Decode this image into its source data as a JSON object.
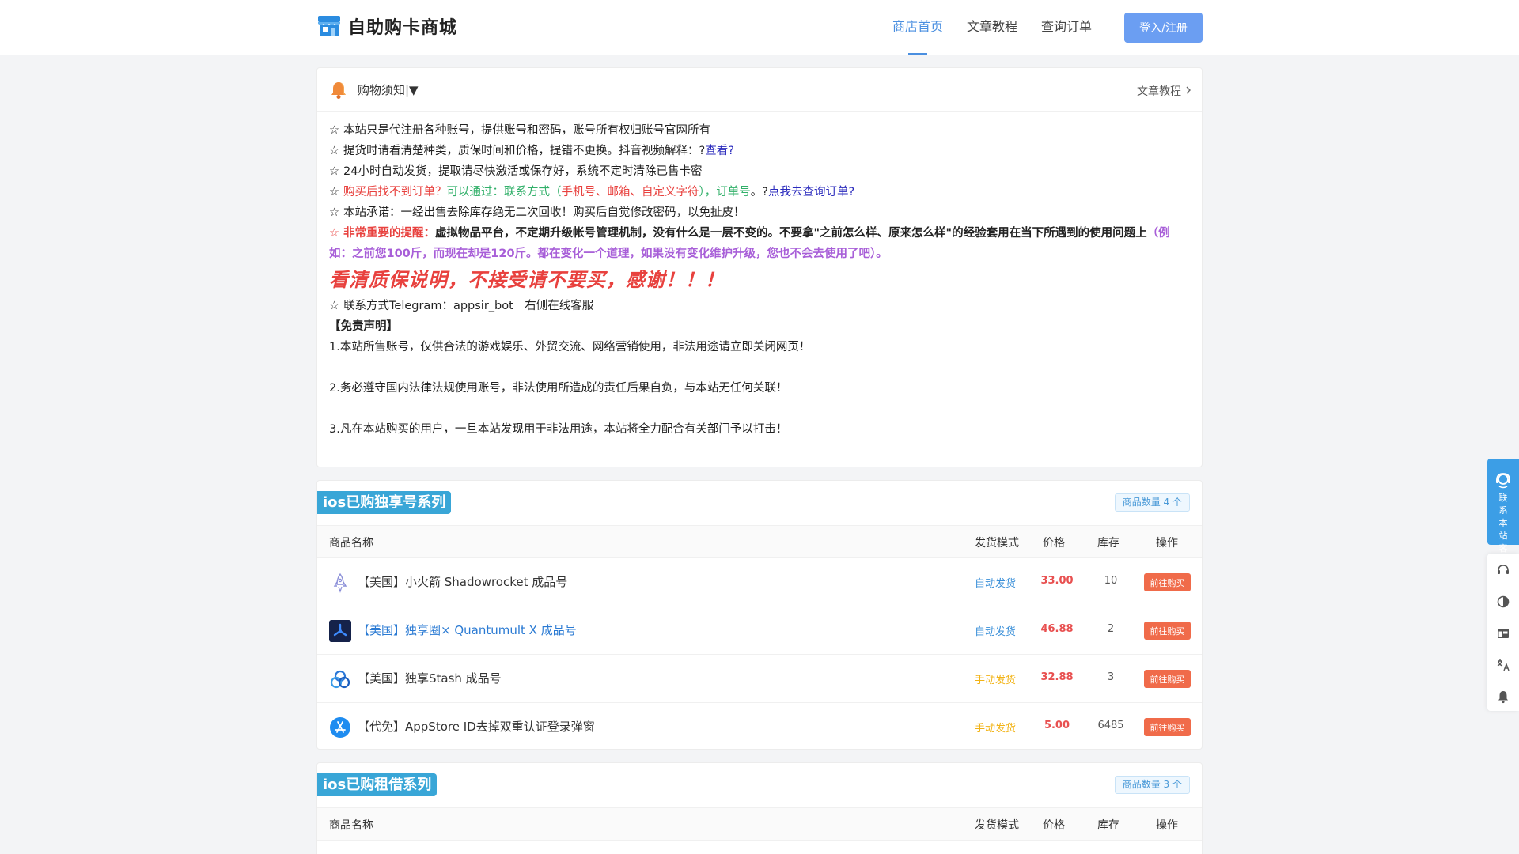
{
  "header": {
    "brand": "自助购卡商城",
    "nav": [
      "商店首页",
      "文章教程",
      "查询订单"
    ],
    "login": "登入/注册"
  },
  "notice": {
    "title": "购物须知|▼",
    "link": "文章教程",
    "star": "☆",
    "l1": "本站只是代注册各种账号，提供账号和密码，账号所有权归账号官网所有",
    "l2a": "提货时请看清楚种类，质保时间和价格，提错不更换。抖音视频解释：?",
    "l2b": "查看?",
    "l3": "24小时自动发货，提取请尽快激活或保存好，系统不定时清除已售卡密",
    "l4a": "购买后找不到订单？",
    "l4b": "可以通过：联系方式（",
    "l4c": "手机号、邮箱、自定义字符",
    "l4d": "），",
    "l4e": "订单号",
    "l4f": "。?",
    "l4g": "点我去查询订单?",
    "l5": "本站承诺：一经出售去除库存绝无二次回收！购买后自觉修改密码，以免扯皮！",
    "l6a": "非常重要的提醒：",
    "l6b": "虚拟物品平台，不定期升级帐号管理机制，没有什么是一层不变的。不要拿\"之前怎么样、原来怎么样\"的经验套用在当下所遇到的使用问题上",
    "l6c": "（例如：之前您100斤，而现在却是120斤。都在变化一个道理，如果没有变化维护升级，您也不会去使用了吧）。",
    "big": "看清质保说明，不接受请不要买，感谢！！！",
    "l7": "联系方式Telegram：appsir_bot　右侧在线客服",
    "disclaimer": "【免责声明】",
    "d1": "1.本站所售账号，仅供合法的游戏娱乐、外贸交流、网络营销使用，非法用途请立即关闭网页！",
    "d2": "2.务必遵守国内法律法规使用账号，非法使用所造成的责任后果自负，与本站无任何关联！",
    "d3": "3.凡在本站购买的用户，一旦本站发现用于非法用途，本站将全力配合有关部门予以打击！"
  },
  "table_headers": [
    "商品名称",
    "发货模式",
    "价格",
    "库存",
    "操作"
  ],
  "buy_label": "前往购买",
  "sections": [
    {
      "title": "ios已购独享号系列",
      "count": "商品数量 4 个",
      "items": [
        {
          "name": "【美国】小火箭 Shadowrocket 成品号",
          "mode": "自动发货",
          "price": "33.00",
          "stock": "10"
        },
        {
          "name": "【美国】独享圈× Quantumult X 成品号",
          "mode": "自动发货",
          "price": "46.88",
          "stock": "2"
        },
        {
          "name": "【美国】独享Stash 成品号",
          "mode": "手动发货",
          "price": "32.88",
          "stock": "3"
        },
        {
          "name": "【代免】AppStore ID去掉双重认证登录弹窗",
          "mode": "手动发货",
          "price": "5.00",
          "stock": "6485"
        }
      ]
    },
    {
      "title": "ios已购租借系列",
      "count": "商品数量 3 个"
    }
  ],
  "floating": {
    "customer_service": "联系本站客服"
  },
  "colors": {
    "accent": "#4a8fe0",
    "tag": "#39a6d7",
    "buy": "#f06b4a",
    "price": "#e85050",
    "warn": "#e8413e"
  }
}
